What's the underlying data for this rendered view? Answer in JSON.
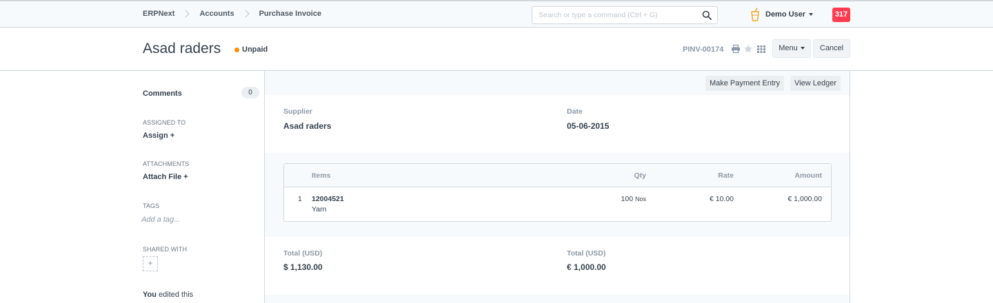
{
  "navbar": {
    "breadcrumbs": [
      "ERPNext",
      "Accounts",
      "Purchase Invoice"
    ],
    "search_placeholder": "Search or type a command (Ctrl + G)",
    "user_name": "Demo User",
    "notification_count": "317"
  },
  "page_head": {
    "title": "Asad raders",
    "status": "Unpaid",
    "doc_name": "PINV-00174",
    "menu_label": "Menu",
    "cancel_label": "Cancel"
  },
  "sidebar": {
    "comments_label": "Comments",
    "comments_count": "0",
    "assigned_to_label": "ASSIGNED TO",
    "assign_link": "Assign +",
    "attachments_label": "ATTACHMENTS",
    "attach_link": "Attach File +",
    "tags_label": "TAGS",
    "tag_placeholder": "Add a tag...",
    "shared_with_label": "SHARED WITH",
    "share_add": "+",
    "edited_user": "You",
    "edited_text": " edited this"
  },
  "main": {
    "make_payment_label": "Make Payment Entry",
    "view_ledger_label": "View Ledger",
    "supplier_label": "Supplier",
    "supplier_value": "Asad raders",
    "date_label": "Date",
    "date_value": "05-06-2015",
    "items_table": {
      "headers": [
        "Items",
        "Qty",
        "Rate",
        "Amount"
      ],
      "rows": [
        {
          "idx": "1",
          "item_code": "12004521",
          "item_name": "Yarn",
          "qty": "100",
          "uom": "Nos",
          "rate": "€ 10.00",
          "amount": "€ 1,000.00"
        }
      ]
    },
    "total_usd_label": "Total (USD)",
    "total_usd_value": "$ 1,130.00",
    "total_label": "Total (USD)",
    "total_value": "€ 1,000.00"
  },
  "colors": {
    "status_dot": "#ff8c00",
    "notification_badge": "#ff3b4f"
  }
}
